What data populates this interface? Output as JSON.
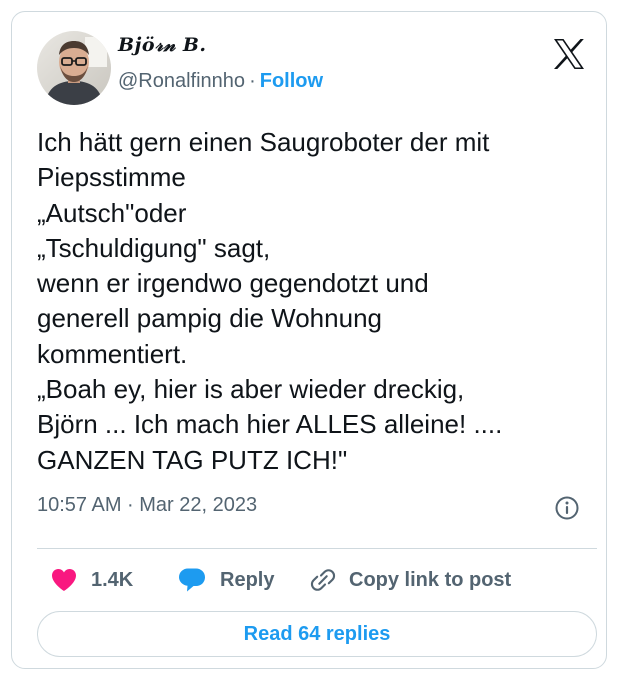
{
  "author": {
    "display_name": "Bjö𝓇𝓃 B.",
    "handle": "@Ronalfinnho",
    "separator": "·",
    "follow_label": "Follow"
  },
  "tweet": {
    "lines": [
      "Ich hätt gern einen Saugroboter der mit",
      "Piepsstimme",
      "„Autsch\"oder",
      "„Tschuldigung\" sagt,",
      "wenn er irgendwo gegendotzt und",
      "generell pampig die Wohnung",
      "kommentiert.",
      "„Boah ey, hier is aber wieder dreckig,",
      "Björn ... Ich mach hier ALLES alleine! ....",
      "GANZEN TAG PUTZ ICH!\""
    ],
    "timestamp": "10:57 AM · Mar 22, 2023"
  },
  "actions": {
    "like_count": "1.4K",
    "reply_label": "Reply",
    "copy_label": "Copy link to post"
  },
  "footer": {
    "read_replies_label": "Read 64 replies"
  },
  "icons": {
    "logo": "x-logo-icon",
    "info": "info-icon",
    "like": "heart-icon",
    "reply": "speech-bubble-icon",
    "copy": "link-icon"
  },
  "colors": {
    "accent": "#1d9bf0",
    "like": "#f91880",
    "text": "#0f1419",
    "secondary_text": "#536471",
    "border": "#cfd9de"
  }
}
